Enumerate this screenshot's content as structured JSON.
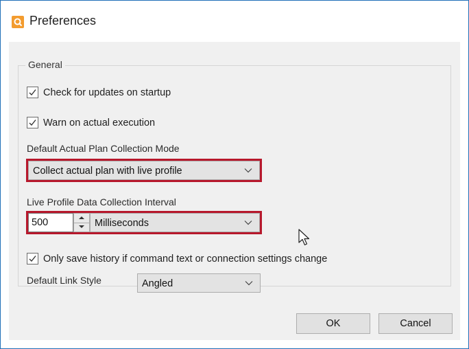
{
  "window": {
    "title": "Preferences"
  },
  "general": {
    "legend": "General",
    "check_updates": {
      "label": "Check for updates on startup",
      "checked": true
    },
    "warn_actual": {
      "label": "Warn on actual execution",
      "checked": true
    },
    "plan_mode": {
      "label": "Default Actual Plan Collection Mode",
      "value": "Collect actual plan with live profile"
    },
    "interval": {
      "label": "Live Profile Data Collection Interval",
      "value": "500",
      "unit": "Milliseconds"
    },
    "history": {
      "label": "Only save history if command text or connection settings change",
      "checked": true
    },
    "link_style": {
      "label": "Default Link Style",
      "value": "Angled"
    }
  },
  "buttons": {
    "ok": "OK",
    "cancel": "Cancel"
  },
  "colors": {
    "highlight": "#b7182c",
    "accent": "#1f6fb8",
    "app_icon": "#f39c2f"
  },
  "icons": [
    "app-icon",
    "checkmark-icon",
    "chevron-down-icon",
    "spin-up-icon",
    "spin-down-icon",
    "mouse-cursor-icon"
  ]
}
